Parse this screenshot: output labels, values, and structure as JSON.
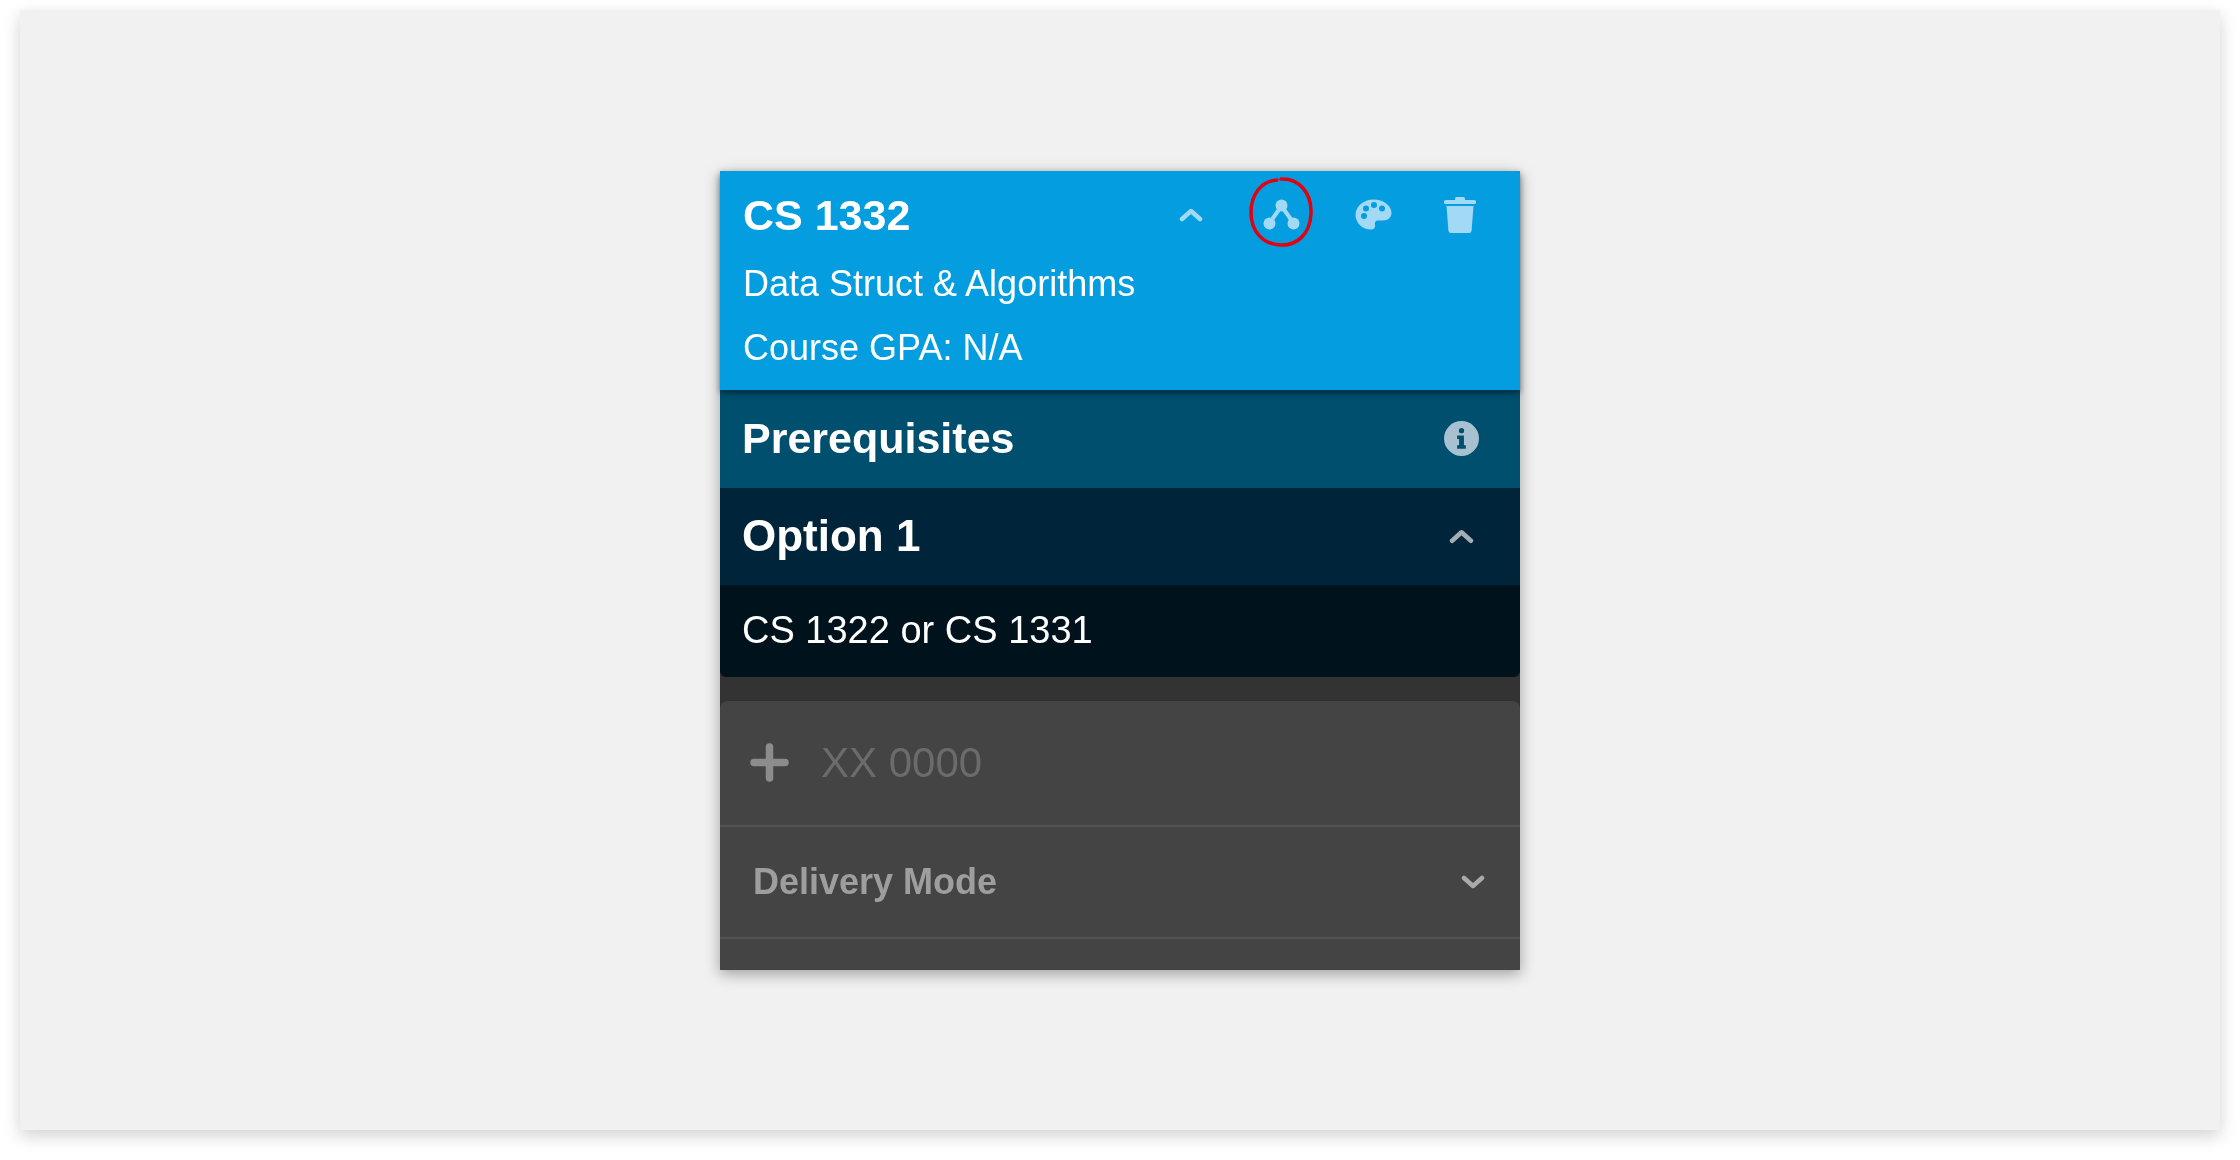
{
  "course": {
    "code": "CS 1332",
    "name": "Data Struct & Algorithms",
    "gpa": "Course GPA: N/A",
    "expanded": true
  },
  "prerequisites": {
    "title": "Prerequisites",
    "options": [
      {
        "label": "Option 1",
        "expanded": true,
        "requirement": "CS 1322 or CS 1331"
      }
    ]
  },
  "course_input": {
    "placeholder": "XX 0000"
  },
  "sections": [
    {
      "label": "Delivery Mode",
      "expanded": false
    }
  ]
}
